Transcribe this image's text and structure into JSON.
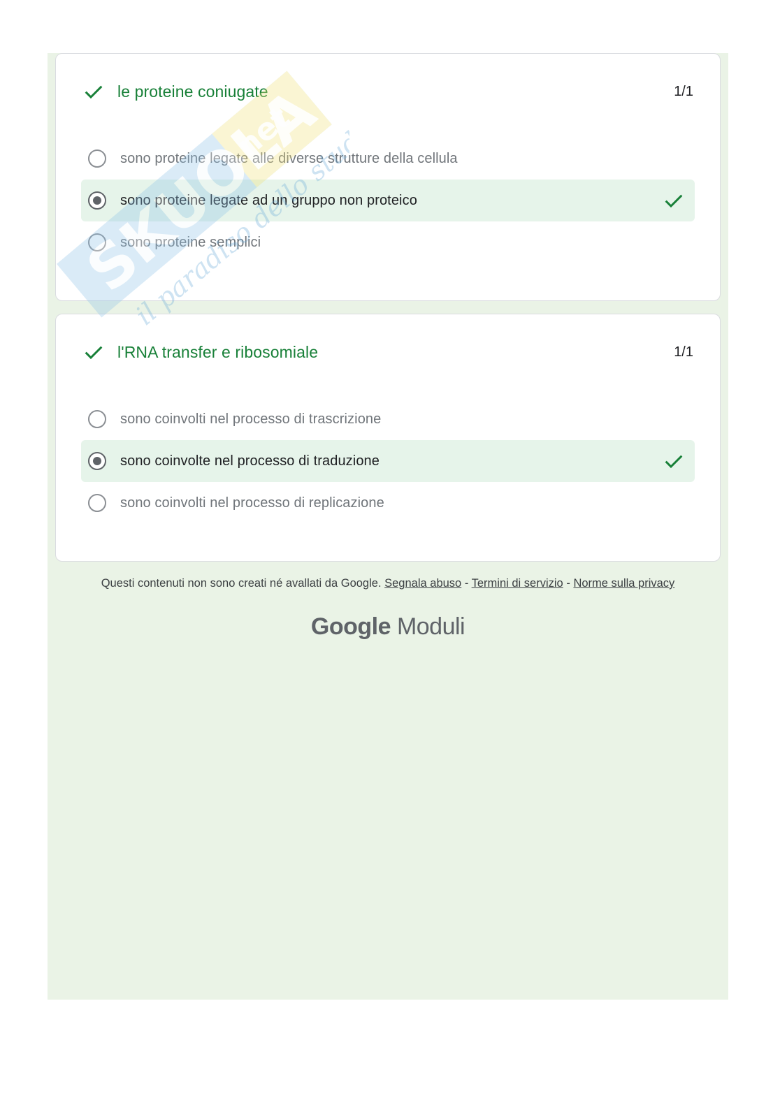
{
  "questions": [
    {
      "title": "le proteine coniugate",
      "score": "1/1",
      "options": [
        {
          "label": "sono proteine legate alle diverse strutture della cellula",
          "selected": false
        },
        {
          "label": "sono proteine legate ad un gruppo non proteico",
          "selected": true
        },
        {
          "label": "sono proteine semplici",
          "selected": false
        }
      ]
    },
    {
      "title": "l'RNA transfer e ribosomiale",
      "score": "1/1",
      "options": [
        {
          "label": "sono coinvolti nel processo di trascrizione",
          "selected": false
        },
        {
          "label": "sono coinvolte nel processo di traduzione",
          "selected": true
        },
        {
          "label": "sono coinvolti nel processo di replicazione",
          "selected": false
        }
      ]
    }
  ],
  "footer": {
    "disclaimer": "Questi contenuti non sono creati né avallati da Google.",
    "report_abuse": "Segnala abuso",
    "separator": "-",
    "terms": "Termini di servizio",
    "privacy": "Norme sulla privacy"
  },
  "brand": {
    "google": "Google",
    "product": "Moduli"
  },
  "watermark": {
    "logo_text": "Skuola.net",
    "tagline": "il paradiso dello studente"
  },
  "colors": {
    "accent_green": "#188038",
    "panel_bg": "#eaf3e6",
    "selected_bg": "#e6f4ea"
  }
}
